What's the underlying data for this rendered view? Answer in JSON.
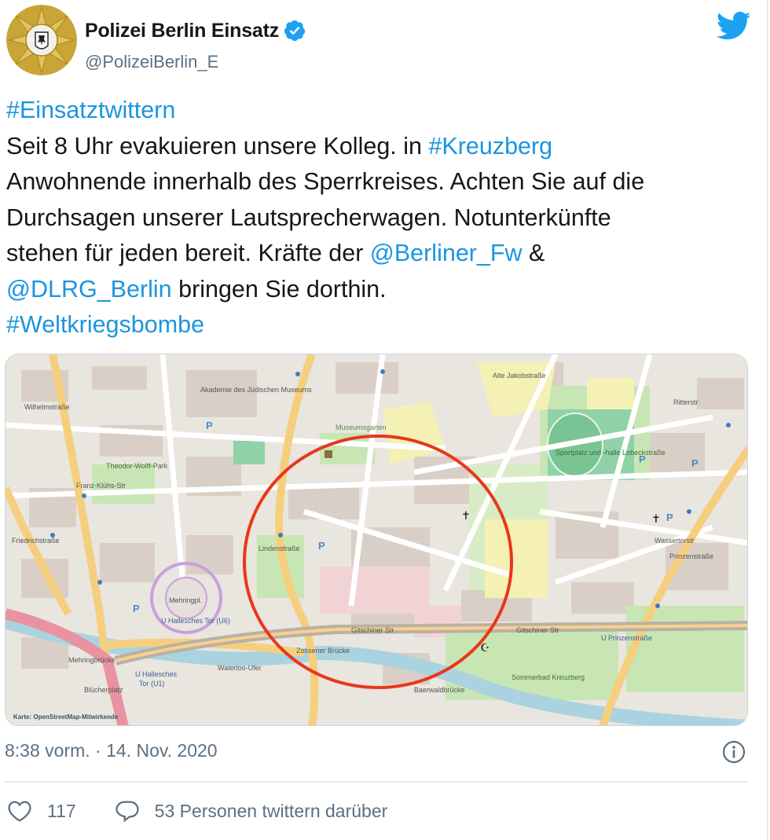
{
  "account": {
    "display_name": "Polizei Berlin Einsatz",
    "handle": "@PolizeiBerlin_E",
    "verified": true,
    "avatar_icon": "police-star-badge-icon"
  },
  "brand": {
    "icon": "twitter-bird-icon",
    "color": "#1da1f2",
    "link_color": "#1b95e0"
  },
  "tweet": {
    "line1_hashtag": "#Einsatztwittern",
    "line2_text": "Seit 8 Uhr evakuieren unsere Kolleg. in ",
    "line2_hashtag": "#Kreuzberg",
    "line3_text": "Anwohnende innerhalb des Sperrkreises. Achten Sie auf die",
    "line4_text": "Durchsagen unserer Lautsprecherwagen. Notunterkünfte",
    "line5_text": "stehen für jeden bereit. Kräfte der ",
    "line5_mention": "@Berliner_Fw",
    "line5_suffix": " &",
    "line6_mention": "@DLRG_Berlin",
    "line6_text": " bringen Sie dorthin.",
    "line7_hashtag": "#Weltkriegsbombe"
  },
  "map": {
    "credit": "Karte: OpenStreetMap-Mitwirkende",
    "circle_color": "#e8371b",
    "labels": {
      "akademie": "Akademie des Jüdischen Museums",
      "museumsgarten": "Museumsgarten",
      "mehringplatz": "Mehringpl.",
      "u_hallesches": "U Hallesches Tor (U6)",
      "u_hallesches_1": "U Hallesches",
      "u_hallesches_2": "Tor (U1)",
      "sportplatz": "Sportplatz und -halle Lobeckstraße",
      "u_prinzenstrasse": "U Prinzenstraße",
      "sommerbad": "Sommerbad Kreuzberg",
      "gitschiner_1": "Gitschiner Str",
      "gitschiner_2": "Gitschiner Str",
      "waterloo": "Waterloo-Ufer",
      "zossener": "Zossener Brücke",
      "mehringbruecke": "Mehringbrücke",
      "theodor": "Theodor-Wolff-Park",
      "franz_kluehs": "Franz-Klühs-Str",
      "lindenstrasse": "Lindenstraße",
      "alte_jakob": "Alte Jakobstraße",
      "ritterstrasse": "Ritterstr",
      "prinzenstrasse": "Prinzenstraße",
      "wassertorstrasse": "Wassertorstr",
      "blucherplatz": "Blücherplatz",
      "baerwaldbruecke": "Baerwaldbrücke",
      "friedrichstrasse": "Friedrichstraße",
      "wilhelmstrasse": "Wilhelmstraße"
    }
  },
  "meta": {
    "timestamp": "8:38 vorm. · 14. Nov. 2020",
    "like_count": "117",
    "reply_label": "53 Personen twittern darüber"
  }
}
